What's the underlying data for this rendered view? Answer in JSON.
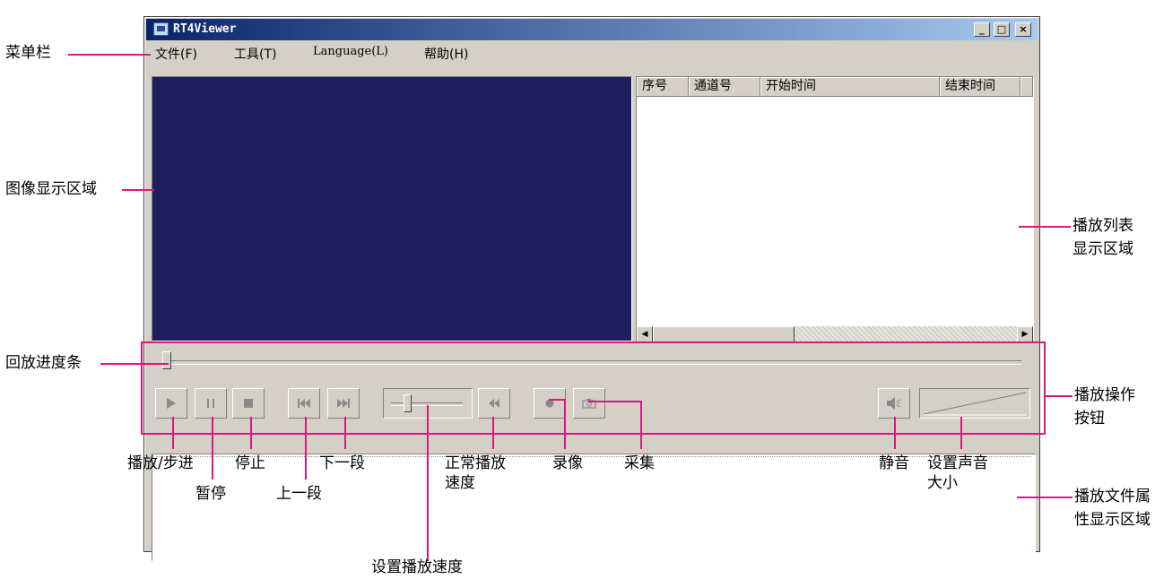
{
  "window": {
    "title": "RT4Viewer",
    "controls": {
      "minimize": "_",
      "maximize": "□",
      "close": "×"
    }
  },
  "menu": {
    "items": [
      "文件(F)",
      "工具(T)",
      "Language(L)",
      "帮助(H)"
    ]
  },
  "playlist": {
    "columns": [
      "序号",
      "通道号",
      "开始时间",
      "结束时间"
    ],
    "rows": []
  },
  "controls": {
    "buttons": [
      "play",
      "pause",
      "stop",
      "previous-segment",
      "next-segment",
      "normal-speed",
      "record",
      "capture",
      "mute"
    ],
    "icons": {
      "play": "play-icon",
      "pause": "pause-icon",
      "stop": "stop-icon",
      "prev": "skip-back-icon",
      "next": "skip-forward-icon",
      "normal": "rewind-icon",
      "record": "record-dot-icon",
      "capture": "camera-icon",
      "mute": "speaker-mute-icon"
    }
  },
  "annotations": {
    "menubar": "菜单栏",
    "image_area": "图像显示区域",
    "progress": "回放进度条",
    "play_step": "播放/步进",
    "pause": "暂停",
    "stop": "停止",
    "prev": "上一段",
    "next": "下一段",
    "normal_speed_1": "正常播放",
    "normal_speed_2": "速度",
    "record": "录像",
    "capture": "采集",
    "mute": "静音",
    "volume_1": "设置声音",
    "volume_2": "大小",
    "set_speed": "设置播放速度",
    "playlist_1": "播放列表",
    "playlist_2": "显示区域",
    "buttons_1": "播放操作",
    "buttons_2": "按钮",
    "props_1": "播放文件属",
    "props_2": "性显示区域"
  },
  "colors": {
    "annotation": "#e0167f",
    "video_bg": "#1f1f5e",
    "window_bg": "#d4d0c8",
    "title_start": "#0a246a",
    "title_end": "#a6caf0"
  }
}
